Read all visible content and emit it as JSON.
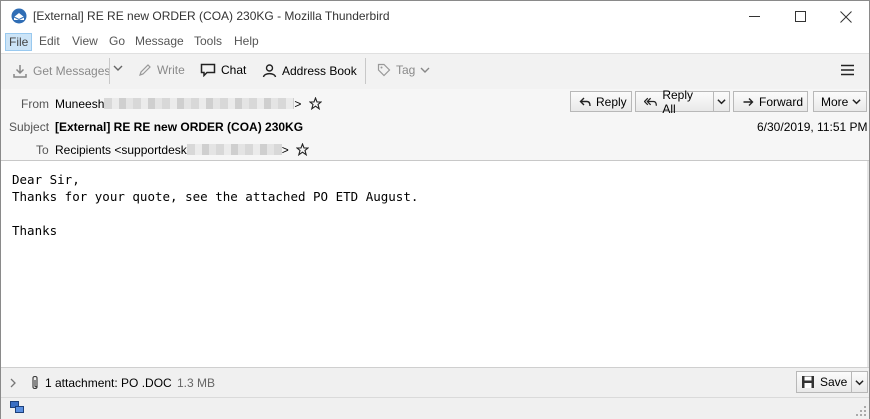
{
  "window": {
    "title": "[External] RE RE new ORDER (COA) 230KG - Mozilla Thunderbird",
    "controls": [
      "minimize-icon",
      "maximize-icon",
      "close-icon"
    ]
  },
  "menu": {
    "items": [
      {
        "label": "File"
      },
      {
        "label": "Edit"
      },
      {
        "label": "View"
      },
      {
        "label": "Go"
      },
      {
        "label": "Message"
      },
      {
        "label": "Tools"
      },
      {
        "label": "Help"
      }
    ]
  },
  "toolbar": {
    "get_messages": "Get Messages",
    "write": "Write",
    "chat": "Chat",
    "address_book": "Address Book",
    "tag": "Tag"
  },
  "header": {
    "from_label": "From",
    "from_name": "Muneesh",
    "from_suffix": ">",
    "subject_label": "Subject",
    "subject": "[External] RE RE new ORDER (COA) 230KG",
    "to_label": "To",
    "to_value": "Recipients <supportdesk",
    "to_suffix": ">",
    "date": "6/30/2019, 11:51 PM",
    "reply": "Reply",
    "reply_all": "Reply All",
    "forward": "Forward",
    "more": "More"
  },
  "message": {
    "lines": [
      "Dear Sir,",
      "Thanks for your quote, see the attached PO ETD August.",
      "",
      "Thanks"
    ]
  },
  "attachment": {
    "summary": "1 attachment: PO .DOC",
    "size": "1.3 MB",
    "save": "Save"
  },
  "colors": {
    "toolbar_bg": "#f2f2f2",
    "header_bg": "#f6f6f6",
    "menu_highlight": "#cce4f7"
  }
}
